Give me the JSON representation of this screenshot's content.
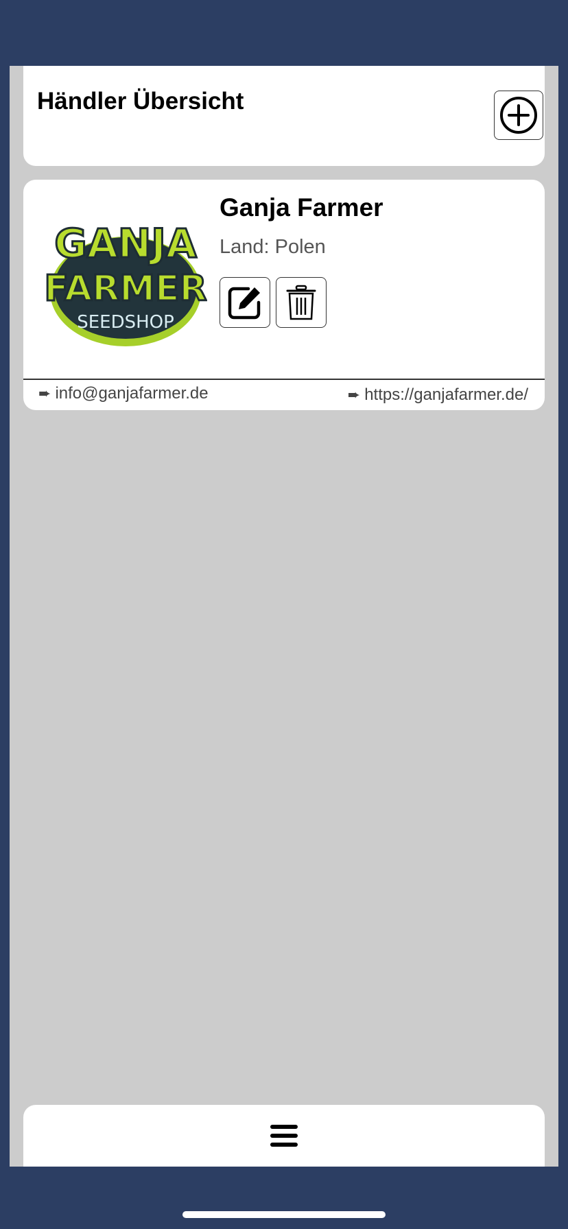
{
  "header": {
    "title": "Händler Übersicht",
    "add_icon": "plus-circle-icon"
  },
  "dealers": [
    {
      "name": "Ganja Farmer",
      "country_text": "Land: Polen",
      "logo": {
        "line1": "GANJA",
        "line2": "FARMER",
        "line3": "SEEDSHOP"
      },
      "email": "info@ganjafarmer.de",
      "website": "https://ganjafarmer.de/",
      "arrow_glyph": "➨",
      "edit_icon": "edit-icon",
      "delete_icon": "trash-icon"
    }
  ],
  "nav": {
    "menu_icon": "hamburger-menu-icon"
  },
  "colors": {
    "frame": "#2c3e63",
    "background": "#cccccc",
    "card": "#ffffff",
    "logo_green": "#b8dc2e",
    "logo_dark": "#1f3a45"
  }
}
